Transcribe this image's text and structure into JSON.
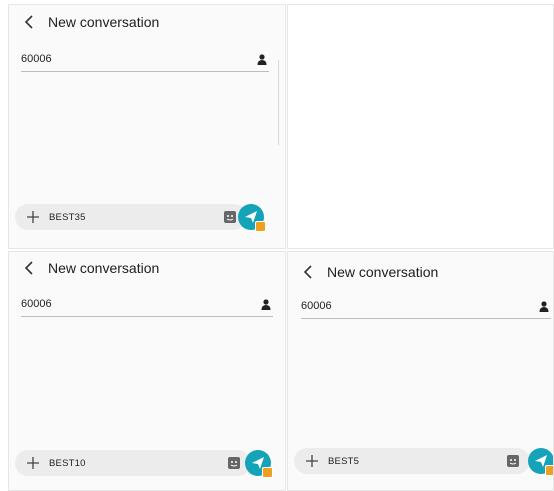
{
  "panels": [
    {
      "title": "New conversation",
      "recipient": "60006",
      "message": "BEST35"
    },
    {
      "title": "New conversation",
      "recipient": "60006",
      "message": "BEST10"
    },
    {
      "title": "New conversation",
      "recipient": "60006",
      "message": "BEST5"
    }
  ],
  "icons": {
    "back": "chevron-left-icon",
    "contact": "person-icon",
    "attach": "plus-icon",
    "sticker": "sticker-icon",
    "send": "send-icon"
  },
  "colors": {
    "send_button": "#14a3b8",
    "sim_badge": "#f0a020",
    "composer": "#ececec"
  }
}
